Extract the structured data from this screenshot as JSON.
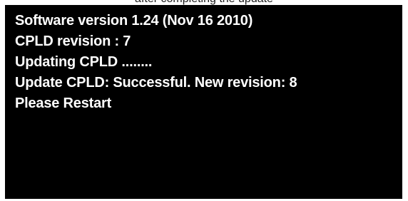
{
  "caption": {
    "text": "after completing the update"
  },
  "screen": {
    "background_color": "#000000",
    "text_color": "#ffffff",
    "lines": [
      "Software version 1.24 (Nov 16 2010)",
      "CPLD revision : 7",
      "Updating CPLD ........",
      "Update CPLD: Successful. New revision: 8",
      "Please Restart"
    ]
  }
}
